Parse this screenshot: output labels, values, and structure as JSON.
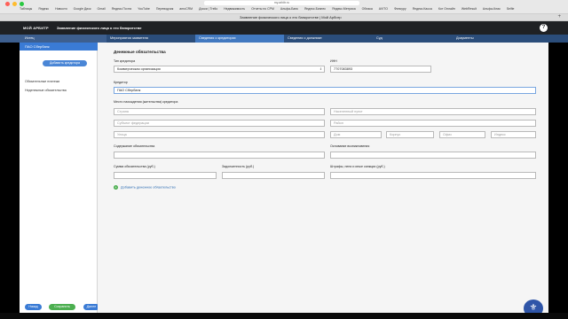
{
  "browser": {
    "url": "my.arbitr.ru",
    "tab_title": "Заявление физического лица о его банкротстве | Мой Арбитр",
    "bookmarks": [
      "Таблицы",
      "Яндекс",
      "Новости",
      "Google Диск",
      "Gmail",
      "Яндекс.Почта",
      "YouTube",
      "Переводчик",
      "amoCRM",
      "Доски | Trello",
      "Недвижимость",
      "Отчеты по CPM",
      "Альфа-Банк",
      "Яндекс.Бизнес",
      "Яндекс.Метрика",
      "Облака",
      "AVITO",
      "Финсуру",
      "Яндекс.Касса",
      "Кот Онлайн",
      "WebResult",
      "Альфа-Клик",
      "Selfie"
    ]
  },
  "app": {
    "logo": "МОЙ АРБИТР",
    "title": "Заявление физического лица о его банкротстве",
    "help_icon": "question-circle-icon"
  },
  "steps": {
    "sidebar_tab": "Истец",
    "items": [
      {
        "label": "Мероприятия заявителя",
        "active": false
      },
      {
        "label": "Сведения о кредиторах",
        "active": true
      },
      {
        "label": "Сведения о должнике",
        "active": false
      },
      {
        "label": "Суд",
        "active": false
      },
      {
        "label": "Документы",
        "active": false
      }
    ]
  },
  "sidebar": {
    "selected_item": "ПАО Сбербанк",
    "add_button": "Добавить кредитора",
    "links": [
      "Обязательные платежи",
      "Неденежные обязательства"
    ],
    "back_button": "Назад",
    "save_button": "Сохранить",
    "next_button": "Далее"
  },
  "form": {
    "section_title": "Денежные обязательства",
    "creditor_type_label": "Тип кредитора",
    "creditor_type_value": "Коммерческая организация",
    "inn_label": "ИНН",
    "inn_value": "7707083893",
    "creditor_label": "Кредитор",
    "creditor_value": "ПАО Сбербанк",
    "location_label": "Место нахождения (жительства) кредитора",
    "address": {
      "country": "Страна",
      "settlement": "Населенный пункт",
      "region": "Субъект федерации",
      "district": "Район",
      "city": "Город",
      "street": "Улица",
      "house": "Дом",
      "building": "Корпус",
      "office": "Офис",
      "index": "Индекс"
    },
    "content_label": "Содержание обязательства",
    "basis_label": "Основание возникновения",
    "amount_label": "Сумма обязательства (руб.)",
    "debt_label": "Задолженность (руб.)",
    "fines_label": "Штрафы, пени и иные санкции (руб.)",
    "add_obligation": "Добавить денежное обязательство"
  },
  "colors": {
    "accent": "#4279c0",
    "header": "#1f2124",
    "save": "#4caf50"
  }
}
